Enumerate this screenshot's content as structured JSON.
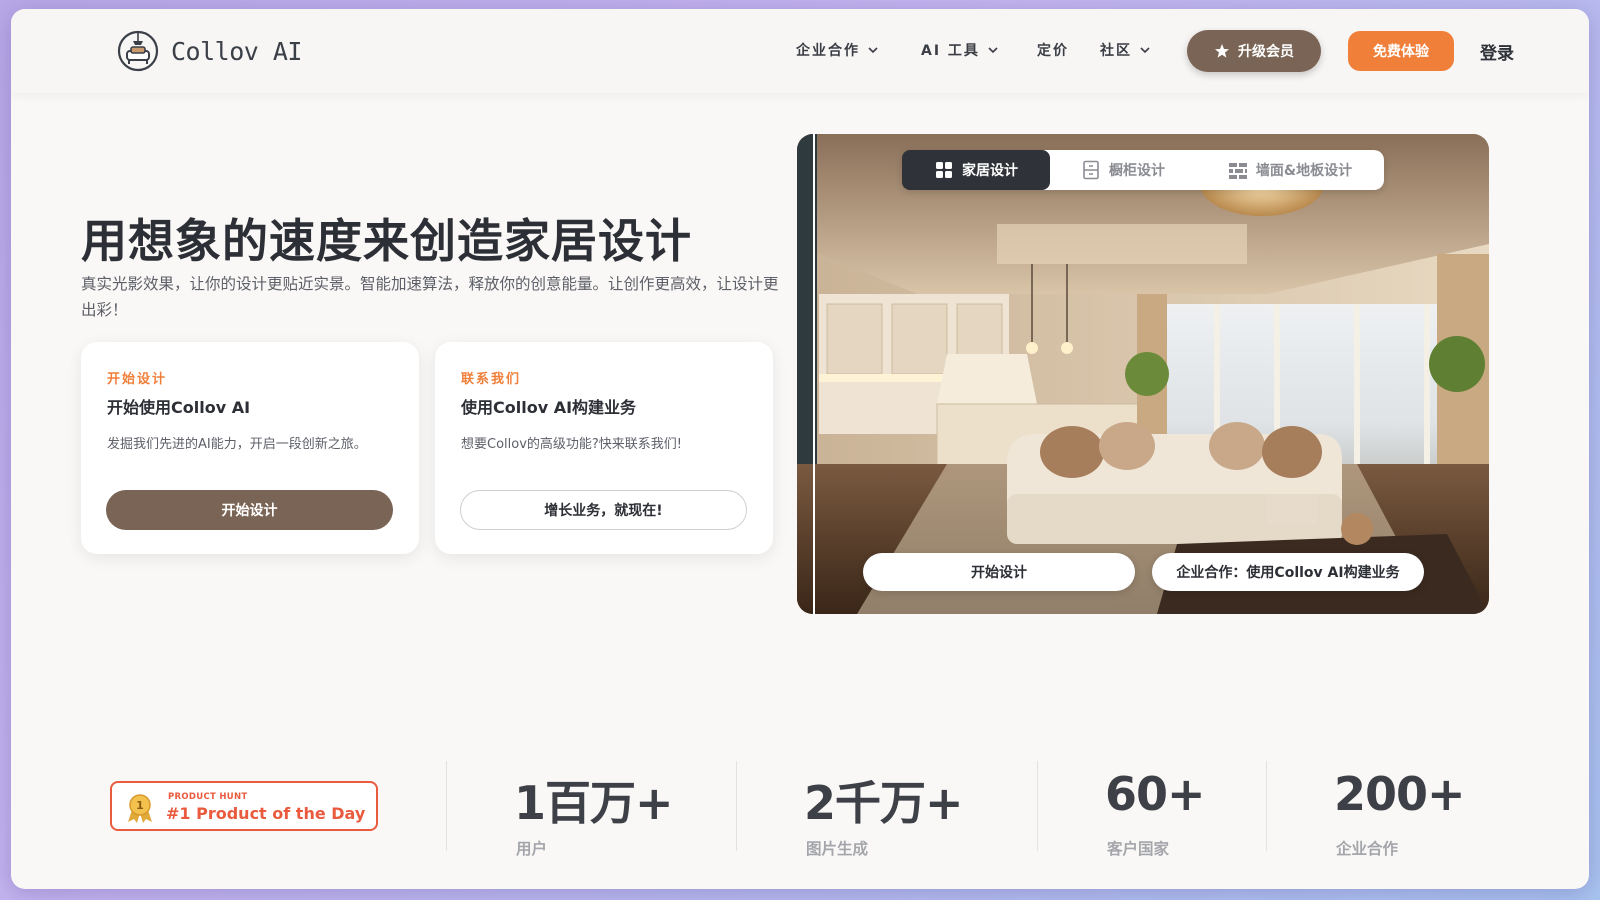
{
  "header": {
    "logo_text": "Collov AI",
    "nav": [
      {
        "label": "企业合作",
        "has_dropdown": true
      },
      {
        "label": "AI 工具",
        "has_dropdown": true
      },
      {
        "label": "定价",
        "has_dropdown": false
      },
      {
        "label": "社区",
        "has_dropdown": true
      }
    ],
    "upgrade_label": "升级会员",
    "free_trial_label": "免费体验",
    "login_label": "登录"
  },
  "hero": {
    "title": "用想象的速度来创造家居设计",
    "subtitle": "真实光影效果，让你的设计更贴近实景。智能加速算法，释放你的创意能量。让创作更高效，让设计更出彩！",
    "cards": [
      {
        "kicker": "开始设计",
        "title": "开始使用Collov AI",
        "description": "发掘我们先进的AI能力，开启一段创新之旅。",
        "button": "开始设计",
        "style": "primary"
      },
      {
        "kicker": "联系我们",
        "title": "使用Collov AI构建业务",
        "description": "想要Collov的高级功能?快来联系我们!",
        "button": "增长业务，就现在!",
        "style": "outline"
      }
    ]
  },
  "showcase": {
    "tabs": [
      {
        "label": "家居设计",
        "icon": "grid-icon",
        "active": true
      },
      {
        "label": "橱柜设计",
        "icon": "cabinet-icon",
        "active": false
      },
      {
        "label": "墙面&地板设计",
        "icon": "tiles-icon",
        "active": false
      }
    ],
    "buttons": [
      "开始设计",
      "企业合作：使用Collov AI构建业务"
    ]
  },
  "stats": {
    "badge_small": "PRODUCT HUNT",
    "badge_big": "#1 Product of the Day",
    "badge_medal_number": "1",
    "items": [
      {
        "value": "1百万+",
        "label": "用户"
      },
      {
        "value": "2千万+",
        "label": "图片生成"
      },
      {
        "value": "60+",
        "label": "客户国家"
      },
      {
        "value": "200+",
        "label": "企业合作"
      }
    ]
  },
  "colors": {
    "brand_brown": "#7a6455",
    "accent_orange": "#f07f3a",
    "product_hunt_red": "#ea5a3e",
    "text_dark": "#2d2f36"
  }
}
